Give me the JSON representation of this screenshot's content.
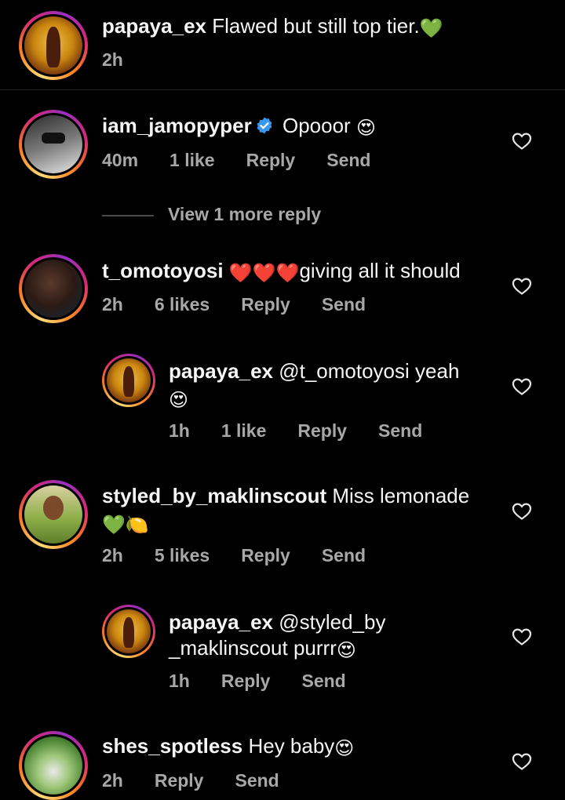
{
  "comments": [
    {
      "username": "papaya_ex",
      "text": "Flawed but still top tier.",
      "emoji": "💚",
      "time": "2h"
    },
    {
      "username": "iam_jamopyper",
      "text": "Opooor",
      "emoji": "😍",
      "time": "40m",
      "likes": "1 like",
      "reply": "Reply",
      "send": "Send",
      "verified": true
    },
    {
      "username": "t_omotoyosi",
      "hearts": "❤️❤️❤️",
      "text": "giving all it should",
      "time": "2h",
      "likes": "6 likes",
      "reply": "Reply",
      "send": "Send"
    },
    {
      "username": "papaya_ex",
      "text": "@t_omotoyosi yeah",
      "emoji": "😍",
      "time": "1h",
      "likes": "1 like",
      "reply": "Reply",
      "send": "Send"
    },
    {
      "username": "styled_by_maklinscout",
      "text": "Miss lemonade",
      "emoji": "💚🍋",
      "time": "2h",
      "likes": "5 likes",
      "reply": "Reply",
      "send": "Send"
    },
    {
      "username": "papaya_ex",
      "text": "@styled_by",
      "text2": "_maklinscout purrr",
      "emoji": "😍",
      "time": "1h",
      "reply": "Reply",
      "send": "Send"
    },
    {
      "username": "shes_spotless",
      "text": "Hey baby",
      "emoji": "😍",
      "time": "2h",
      "reply": "Reply",
      "send": "Send"
    }
  ],
  "view_more_replies": "View 1 more reply",
  "icons": {
    "like": "heart-outline-icon",
    "verified": "verified-badge-icon"
  },
  "colors": {
    "background": "#000000",
    "primary_text": "#f5f5f5",
    "secondary_text": "#a8a8a8",
    "verified_blue": "#3897f0"
  }
}
